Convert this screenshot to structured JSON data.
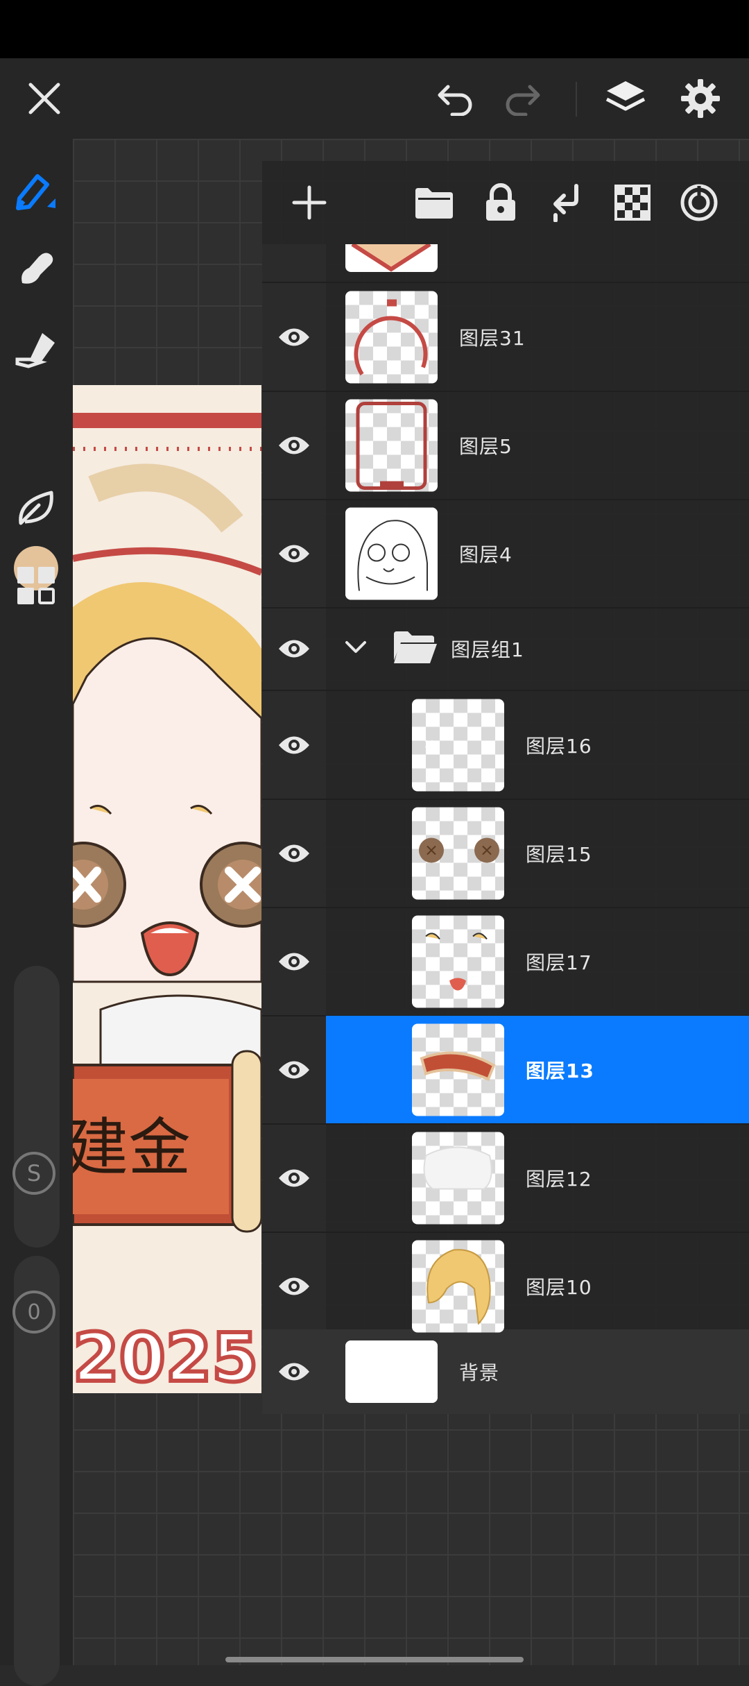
{
  "colors": {
    "accent": "#0a7bff",
    "current_color": "#e4c29a"
  },
  "topbar": {
    "close_icon": "close-icon",
    "undo_icon": "undo-icon",
    "redo_icon": "redo-icon",
    "layers_icon": "layers-icon",
    "settings_icon": "gear-icon"
  },
  "left_tools": [
    "brush-icon",
    "smudge-icon",
    "eraser-icon",
    "color-swatch",
    "leaf-icon",
    "grid-icon"
  ],
  "sliders": {
    "size_label": "S",
    "opacity_label": "0"
  },
  "artwork": {
    "year_text": "2025",
    "banner_chars": "建金"
  },
  "layers_panel": {
    "toolbar": [
      "add-layer-icon",
      "folder-icon",
      "lock-icon",
      "merge-down-icon",
      "transparency-icon",
      "target-icon"
    ],
    "layers": [
      {
        "name": "图层31"
      },
      {
        "name": "图层5"
      },
      {
        "name": "图层4"
      },
      {
        "name": "图层组1",
        "group": true
      },
      {
        "name": "图层16"
      },
      {
        "name": "图层15"
      },
      {
        "name": "图层17"
      },
      {
        "name": "图层13",
        "selected": true
      },
      {
        "name": "图层12"
      },
      {
        "name": "图层10"
      },
      {
        "name": "背景"
      }
    ]
  }
}
